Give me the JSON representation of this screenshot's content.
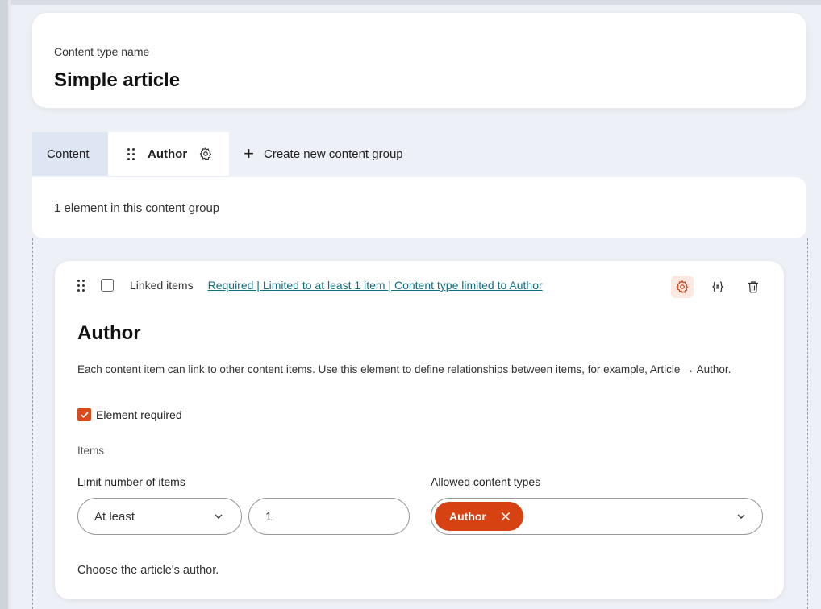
{
  "header": {
    "name_label": "Content type name",
    "name_value": "Simple article"
  },
  "tabs": [
    {
      "label": "Content"
    },
    {
      "label": "Author"
    },
    {
      "label": "Create new content group"
    }
  ],
  "group": {
    "summary": "1 element in this content group"
  },
  "element": {
    "type_label": "Linked items",
    "summary_link": "Required | Limited to at least 1 item | Content type limited to Author",
    "title": "Author",
    "description": "Each content item can link to other content items. Use this element to define relationships between items, for example, Article → Author.",
    "required_label": "Element required",
    "required_checked": true,
    "section_label": "Items",
    "limit_label": "Limit number of items",
    "limit_mode": "At least",
    "limit_value": "1",
    "allowed_label": "Allowed content types",
    "allowed_types": [
      "Author"
    ],
    "guidelines": "Choose the article's author."
  },
  "colors": {
    "accent": "#d64212",
    "link": "#0e6f82",
    "tab_active_bg": "#dde6f2",
    "page_bg": "#edf0f6"
  },
  "icons": {
    "drag": "drag-handle-icon",
    "gear": "gear-icon",
    "plus": "plus-icon",
    "snippet": "code-bracket-icon",
    "delete": "trash-icon",
    "chevron": "chevron-down-icon",
    "close": "close-icon",
    "check": "check-icon"
  }
}
